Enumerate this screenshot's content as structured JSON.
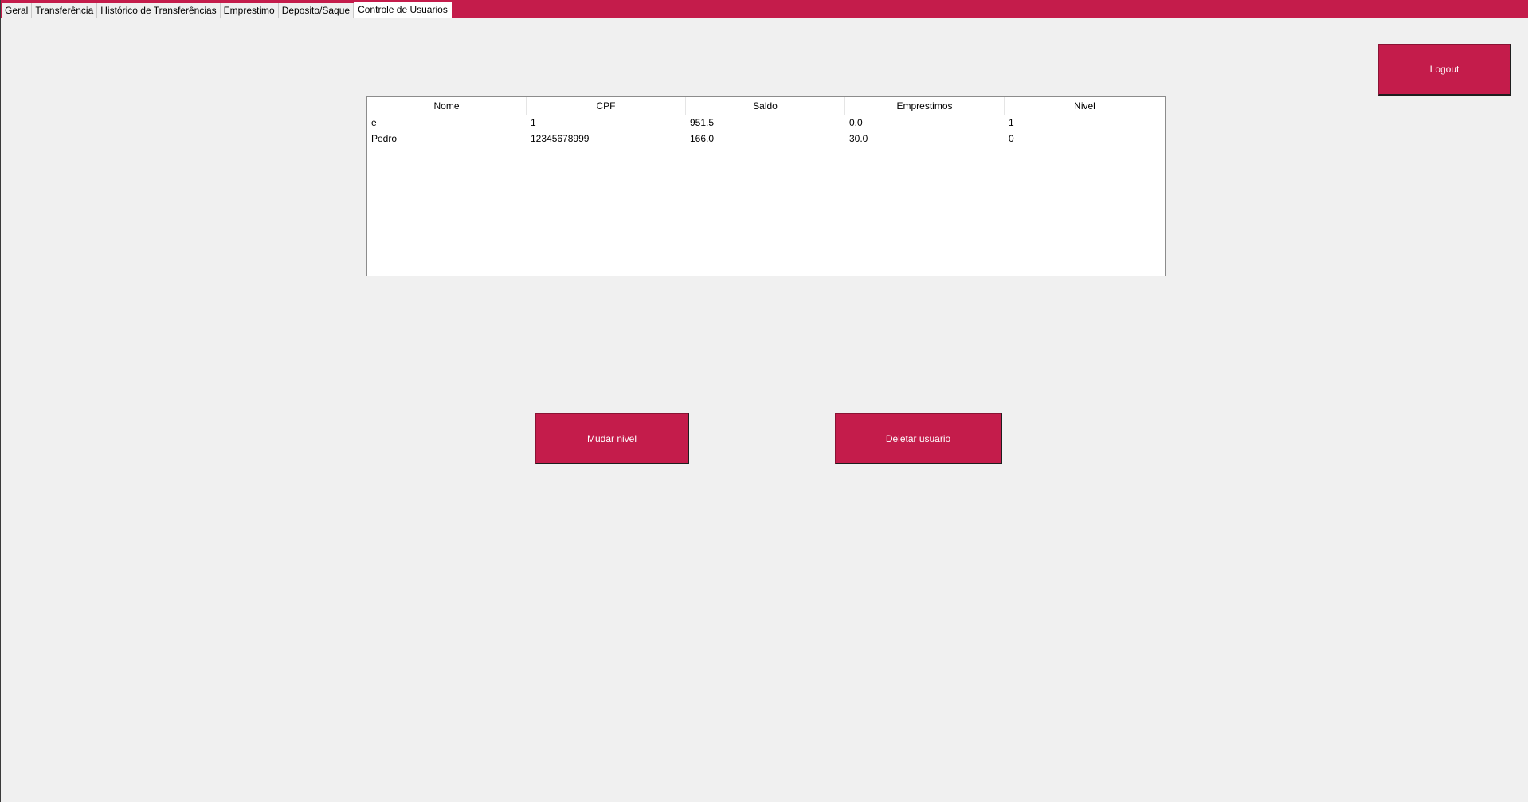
{
  "tabs": [
    {
      "label": "Geral"
    },
    {
      "label": "Transferência"
    },
    {
      "label": "Histórico de Transferências"
    },
    {
      "label": "Emprestimo"
    },
    {
      "label": "Deposito/Saque"
    },
    {
      "label": "Controle de Usuarios",
      "active": true
    }
  ],
  "buttons": {
    "logout": "Logout",
    "mudar_nivel": "Mudar nivel",
    "deletar_usuario": "Deletar usuario"
  },
  "table": {
    "columns": [
      "Nome",
      "CPF",
      "Saldo",
      "Emprestimos",
      "Nivel"
    ],
    "rows": [
      [
        "e",
        "1",
        "951.5",
        "0.0",
        "1"
      ],
      [
        "Pedro",
        "12345678999",
        "166.0",
        "30.0",
        "0"
      ]
    ]
  },
  "colors": {
    "accent": "#c41c4b",
    "background": "#f0f0f0"
  }
}
